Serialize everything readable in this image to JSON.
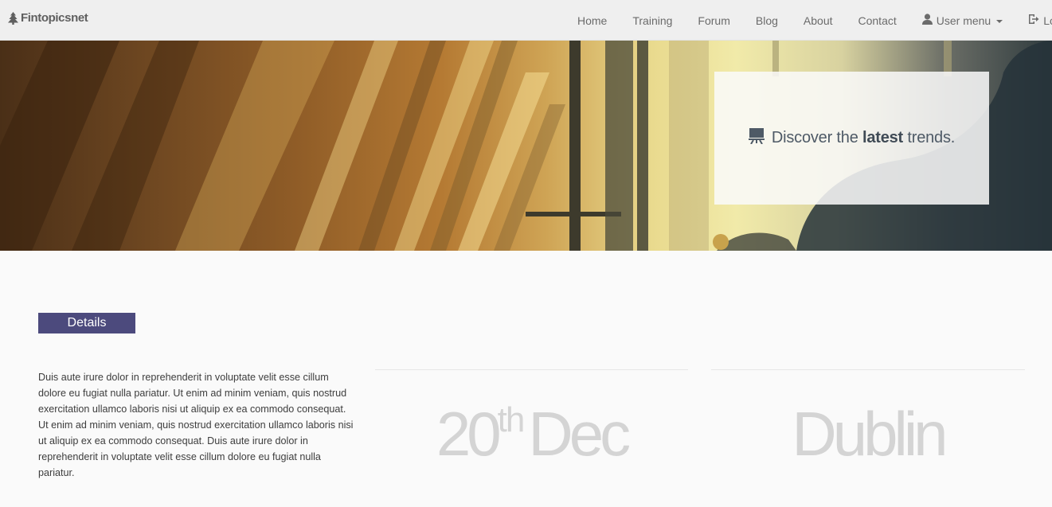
{
  "brand": {
    "name": "Fintopicsnet",
    "icon": "tree-icon"
  },
  "nav": {
    "items": [
      {
        "label": "Home"
      },
      {
        "label": "Training"
      },
      {
        "label": "Forum"
      },
      {
        "label": "Blog"
      },
      {
        "label": "About"
      },
      {
        "label": "Contact"
      }
    ],
    "user_menu": {
      "label": "User menu",
      "icon": "user-icon"
    },
    "logout": {
      "label": "Log Out",
      "icon": "log-out-icon"
    }
  },
  "hero": {
    "callout": {
      "icon": "presentation-board-icon",
      "prefix": "Discover the ",
      "emphasis": "latest",
      "suffix": " trends."
    }
  },
  "details": {
    "badge": "Details",
    "text": "Duis aute irure dolor in reprehenderit in voluptate velit esse cillum dolore eu fugiat nulla pariatur. Ut enim ad minim veniam, quis nostrud exercitation ullamco laboris nisi ut aliquip ex ea commodo consequat. Ut enim ad minim veniam, quis nostrud exercitation ullamco laboris nisi ut aliquip ex ea commodo consequat. Duis aute irure dolor in reprehenderit in voluptate velit esse cillum dolore eu fugiat nulla pariatur.",
    "date": {
      "day": "20",
      "suffix": "th",
      "month": "Dec"
    },
    "location": "Dublin"
  },
  "colors": {
    "accent": "#4c4a7d",
    "navbar_bg": "#efefef",
    "muted_stat": "#d4d4d4"
  }
}
